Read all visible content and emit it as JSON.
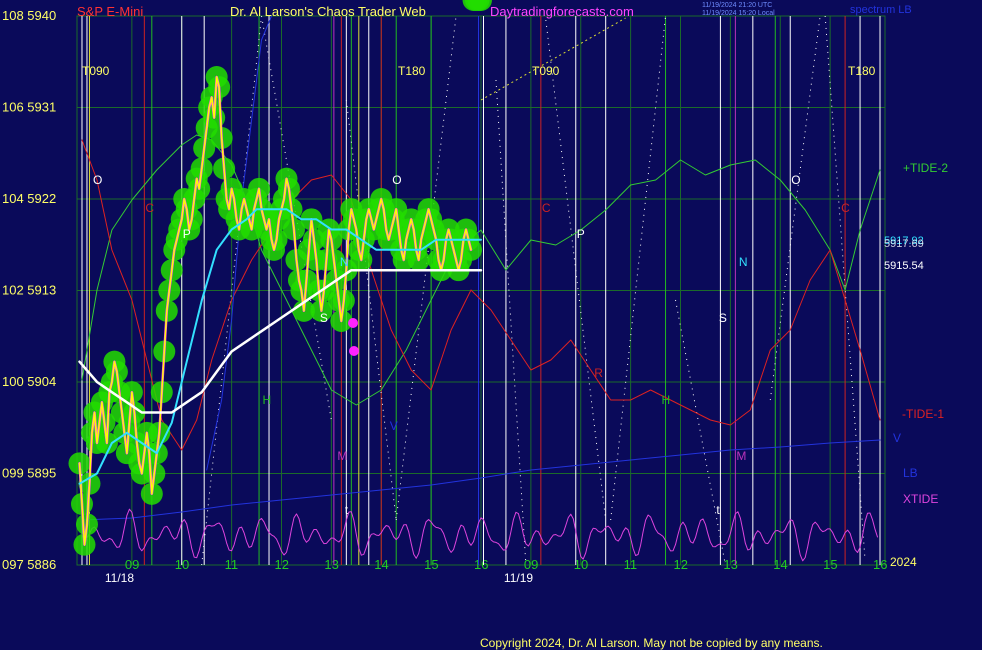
{
  "header": {
    "instrument": "S&P E-Mini",
    "site_title": "Dr. Al Larson's Chaos Trader Web",
    "site_url": "Daytradingforecasts.com",
    "timestamp_1": "11/19/2024 21:20 UTC",
    "timestamp_2": "11/19/2024 15:20 Local",
    "spectrum_label": "spectrum LB",
    "copyright": "Copyright 2024, Dr. Al Larson. May not be copied by any means."
  },
  "colors": {
    "background": "#0a0a5a",
    "grid": "#1b6b2a",
    "price_glow": "#22dd00",
    "price_line": "#ffff00",
    "price_inner": "#ff44ff",
    "ema_fast": "#33e0ff",
    "ema_slow": "#ffffff",
    "tide_plus2": "#33cc33",
    "tide_minus1": "#dd2222",
    "xtide": "#dd44dd",
    "lb": "#2233dd",
    "y_labels": "#ffff66",
    "x_labels": "#22cc22",
    "vert_white": "#ffffff",
    "vert_red": "#cc2222",
    "vert_green": "#22bb22",
    "vert_magenta": "#bb33bb",
    "vert_blue": "#2233dd",
    "vert_yellow": "#dddd33"
  },
  "chart_data": {
    "type": "line",
    "title": "S&P E-Mini",
    "y_ticks": [
      {
        "value": 5886,
        "label": "097  5886"
      },
      {
        "value": 5895,
        "label": "099  5895"
      },
      {
        "value": 5904,
        "label": "100  5904"
      },
      {
        "value": 5913,
        "label": "102  5913"
      },
      {
        "value": 5922,
        "label": "104  5922"
      },
      {
        "value": 5931,
        "label": "106  5931"
      },
      {
        "value": 5940,
        "label": "108  5940"
      }
    ],
    "ylim": [
      5886,
      5940
    ],
    "x_hour_labels": [
      {
        "x": 9.0,
        "label": "09"
      },
      {
        "x": 10.0,
        "label": "10"
      },
      {
        "x": 11.0,
        "label": "11"
      },
      {
        "x": 12.0,
        "label": "12"
      },
      {
        "x": 13.0,
        "label": "13"
      },
      {
        "x": 14.0,
        "label": "14"
      },
      {
        "x": 15.0,
        "label": "15"
      },
      {
        "x": 16.0,
        "label": "16"
      },
      {
        "x": 17.0,
        "label": "09"
      },
      {
        "x": 18.0,
        "label": "10"
      },
      {
        "x": 19.0,
        "label": "11"
      },
      {
        "x": 20.0,
        "label": "12"
      },
      {
        "x": 21.0,
        "label": "13"
      },
      {
        "x": 22.0,
        "label": "14"
      },
      {
        "x": 23.0,
        "label": "15"
      },
      {
        "x": 24.0,
        "label": "16"
      }
    ],
    "x_date_labels": [
      {
        "x": 8.7,
        "label": "11/18"
      },
      {
        "x": 16.7,
        "label": "11/19"
      }
    ],
    "year_label": "2024",
    "xlim": [
      7.9,
      24.1
    ],
    "price": {
      "x": [
        7.95,
        8.0,
        8.05,
        8.1,
        8.15,
        8.2,
        8.25,
        8.3,
        8.35,
        8.4,
        8.45,
        8.5,
        8.55,
        8.6,
        8.65,
        8.7,
        8.75,
        8.8,
        8.85,
        8.9,
        8.95,
        9.0,
        9.05,
        9.1,
        9.15,
        9.2,
        9.25,
        9.3,
        9.35,
        9.4,
        9.45,
        9.5,
        9.55,
        9.6,
        9.65,
        9.7,
        9.75,
        9.8,
        9.85,
        9.9,
        9.95,
        10.0,
        10.05,
        10.1,
        10.15,
        10.2,
        10.25,
        10.3,
        10.35,
        10.4,
        10.45,
        10.5,
        10.55,
        10.6,
        10.65,
        10.7,
        10.75,
        10.8,
        10.85,
        10.9,
        10.95,
        11.0,
        11.05,
        11.1,
        11.15,
        11.2,
        11.25,
        11.3,
        11.35,
        11.4,
        11.45,
        11.5,
        11.55,
        11.6,
        11.65,
        11.7,
        11.75,
        11.8,
        11.85,
        11.9,
        11.95,
        12.0,
        12.05,
        12.1,
        12.15,
        12.2,
        12.25,
        12.3,
        12.35,
        12.4,
        12.45,
        12.5,
        12.55,
        12.6,
        12.65,
        12.7,
        12.75,
        12.8,
        12.85,
        12.9,
        12.95,
        13.0,
        13.05,
        13.1,
        13.15,
        13.2,
        13.25,
        13.3,
        13.35,
        13.4,
        13.45,
        13.5,
        13.55,
        13.6,
        13.65,
        13.7,
        13.75,
        13.8,
        13.85,
        13.9,
        13.95,
        14.0,
        14.05,
        14.1,
        14.15,
        14.2,
        14.25,
        14.3,
        14.35,
        14.4,
        14.45,
        14.5,
        14.55,
        14.6,
        14.65,
        14.7,
        14.75,
        14.8,
        14.85,
        14.9,
        14.95,
        15.0,
        15.05,
        15.1,
        15.15,
        15.2,
        15.25,
        15.3,
        15.35,
        15.4,
        15.45,
        15.5,
        15.55,
        15.6,
        15.65,
        15.7,
        15.75,
        15.8,
        15.85,
        15.9,
        15.95,
        16.0
      ],
      "y": [
        5896,
        5892,
        5888,
        5890,
        5894,
        5899,
        5901,
        5898,
        5900,
        5902,
        5900,
        5898,
        5903,
        5904,
        5906,
        5905,
        5903,
        5901,
        5899,
        5897,
        5900,
        5903,
        5901,
        5898,
        5896,
        5895,
        5897,
        5899,
        5897,
        5893,
        5895,
        5897,
        5899,
        5903,
        5907,
        5911,
        5913,
        5915,
        5917,
        5918,
        5919,
        5920,
        5922,
        5921,
        5919,
        5920,
        5922,
        5924,
        5923,
        5925,
        5927,
        5929,
        5931,
        5932,
        5930,
        5934,
        5933,
        5928,
        5925,
        5922,
        5921,
        5923,
        5922,
        5920,
        5919,
        5921,
        5922,
        5921,
        5920,
        5919,
        5921,
        5922,
        5923,
        5921,
        5920,
        5919,
        5920,
        5918,
        5917,
        5918,
        5920,
        5921,
        5922,
        5924,
        5923,
        5921,
        5919,
        5916,
        5914,
        5913,
        5911,
        5914,
        5917,
        5920,
        5918,
        5916,
        5913,
        5911,
        5913,
        5916,
        5919,
        5918,
        5916,
        5914,
        5912,
        5910,
        5912,
        5915,
        5919,
        5921,
        5920,
        5919,
        5917,
        5916,
        5918,
        5920,
        5921,
        5920,
        5919,
        5920,
        5921,
        5922,
        5921,
        5919,
        5918,
        5919,
        5920,
        5921,
        5919,
        5917,
        5916,
        5918,
        5919,
        5920,
        5919,
        5917,
        5916,
        5918,
        5919,
        5920,
        5921,
        5920,
        5919,
        5918,
        5916,
        5915,
        5916,
        5918,
        5919,
        5918,
        5917,
        5916,
        5915,
        5916,
        5918,
        5919,
        5918,
        5917
      ]
    },
    "ema_fast": {
      "x": [
        7.95,
        8.3,
        8.6,
        8.9,
        9.2,
        9.5,
        9.8,
        10.1,
        10.4,
        10.7,
        11.0,
        11.3,
        11.5,
        11.8,
        12.1,
        12.4,
        12.7,
        13.0,
        13.3,
        13.6,
        13.9,
        14.2,
        14.5,
        14.8,
        15.1,
        15.4,
        15.7,
        16.0
      ],
      "y": [
        5894,
        5895,
        5898,
        5899,
        5898,
        5897,
        5900,
        5906,
        5912,
        5917,
        5919,
        5920,
        5921,
        5921,
        5921,
        5920,
        5920,
        5919,
        5919,
        5918,
        5917,
        5917,
        5917,
        5917,
        5918,
        5918,
        5918,
        5918
      ]
    },
    "ema_slow": {
      "x": [
        7.95,
        8.3,
        8.6,
        8.9,
        9.2,
        9.5,
        9.8,
        10.1,
        10.4,
        10.7,
        11.0,
        11.3,
        11.6,
        11.9,
        12.2,
        12.5,
        12.8,
        13.1,
        13.4,
        13.7,
        14.0,
        14.3,
        14.6,
        14.9,
        15.2,
        15.5,
        15.8,
        16.0
      ],
      "y": [
        5906,
        5904,
        5903,
        5902,
        5901,
        5901,
        5901,
        5902,
        5903,
        5905,
        5907,
        5908,
        5909,
        5910,
        5911,
        5912,
        5913,
        5914,
        5915,
        5915,
        5915,
        5915,
        5915,
        5915,
        5915,
        5915,
        5915,
        5915
      ]
    },
    "series_labels": {
      "tide_plus2": "+TIDE-2",
      "tide_minus1": "-TIDE-1",
      "lb": "LB",
      "xtide": "XTIDE",
      "v": "V"
    },
    "value_labels": [
      "5917.92",
      "5917.69",
      "5915.54"
    ],
    "markers": {
      "t90_left": "T090",
      "t180_left": "T180",
      "t90_right": "T090",
      "t180_right": "T180",
      "letters": [
        {
          "x": 8.3,
          "label": "O",
          "color": "#ffffff"
        },
        {
          "x": 9.35,
          "label": "C",
          "color": "#cc2222"
        },
        {
          "x": 10.1,
          "label": "P",
          "color": "#ffffff"
        },
        {
          "x": 11.7,
          "label": "H",
          "color": "#22bb22"
        },
        {
          "x": 12.85,
          "label": "S",
          "color": "#ffffff"
        },
        {
          "x": 13.2,
          "label": "M",
          "color": "#bb33bb"
        },
        {
          "x": 13.25,
          "label": "N",
          "color": "#33e0ff"
        },
        {
          "x": 13.35,
          "label": "t",
          "color": "#ffffff"
        },
        {
          "x": 14.3,
          "label": "O",
          "color": "#ffffff"
        },
        {
          "x": 14.25,
          "label": "V",
          "color": "#2233dd"
        },
        {
          "x": 17.3,
          "label": "C",
          "color": "#cc2222"
        },
        {
          "x": 18.0,
          "label": "P",
          "color": "#ffffff"
        },
        {
          "x": 18.35,
          "label": "R",
          "color": "#cc2222"
        },
        {
          "x": 19.7,
          "label": "H",
          "color": "#22bb22"
        },
        {
          "x": 20.85,
          "label": "S",
          "color": "#ffffff"
        },
        {
          "x": 21.2,
          "label": "M",
          "color": "#bb33bb"
        },
        {
          "x": 21.25,
          "label": "N",
          "color": "#33e0ff"
        },
        {
          "x": 20.8,
          "label": "t",
          "color": "#ffffff"
        },
        {
          "x": 22.3,
          "label": "O",
          "color": "#ffffff"
        },
        {
          "x": 23.3,
          "label": "C",
          "color": "#cc2222"
        }
      ]
    }
  }
}
